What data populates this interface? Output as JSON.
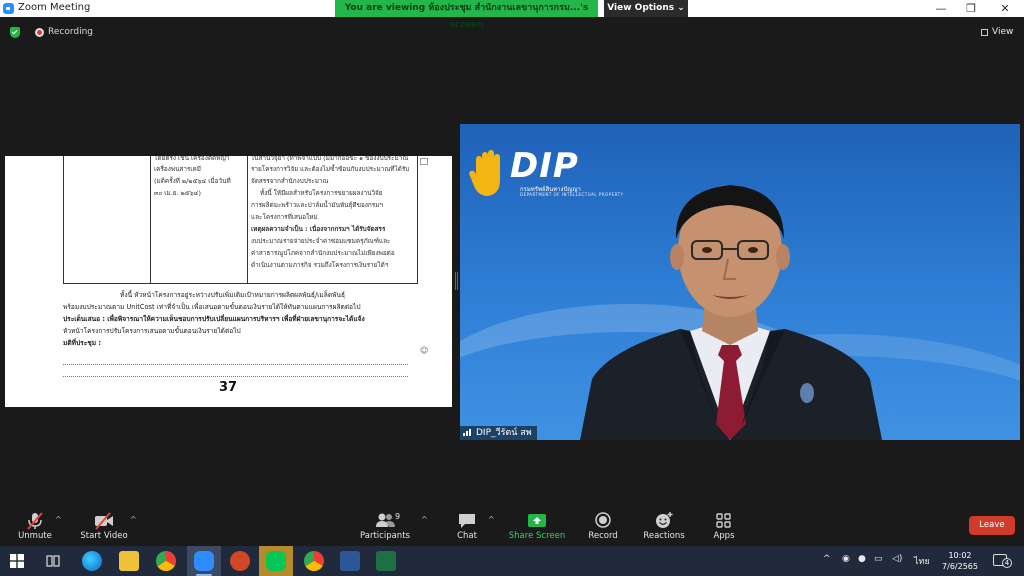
{
  "window": {
    "title": "Zoom Meeting",
    "viewing_banner": "You are viewing ห้องประชุม สำนักงานเลขานุการกรม...'s screen",
    "view_options": "View Options",
    "view_options_chevron": "⌄",
    "minimize": "—",
    "restore": "❐",
    "close": "✕"
  },
  "meeting": {
    "recording_label": "Recording",
    "view_label": "View"
  },
  "document": {
    "cell_col2": [
      "โดยตรง เช่น เครื่องตัดหญ้า",
      "เครื่องพ่นสารเคมี",
      "(มติครั้งที่ ๒/๒๕๖๔ เมื่อวันที่",
      "๓๐ เม.ย. ๒๕๖๔)"
    ],
    "cell_col3": [
      "ในสานวจุยา (ทาพจาแบบ (มมาก้ออขะ ๑ ของงบประมาณ",
      "รายโครงการวิจัย และต้องไม่ซ้ำซ้อนกับงบประมาณที่ได้รับ",
      "จัดสรรจากสำนักงบประมาณ",
      "ทั้งนี้ ให้มีผลสำหรับโครงการขยายผลงานวิจัย",
      "การผลิตมะพร้าวและปาล์มน้ำมันพันธุ์ดีของกรมฯ",
      "และโครงการที่เสนอใหม่",
      "เหตุผลความจำเป็น : เนื่องจากกรมฯ ได้รับจัดสรร",
      "งบประมาณรายจ่ายประจำค่าซ่อมแซมครุภัณฑ์และ",
      "ค่าสาธารณูปโภคจากสำนักงบประมาณไม่เพียงพอต่อ",
      "ดำเนินงานตามภารกิจ รวมถึงโครงการเงินรายได้ฯ"
    ],
    "paragraph": [
      "ทั้งนี้ หัวหน้าโครงการอยู่ระหว่างปรับเพิ่มเติมเป้าหมายการผลิตผลพันธุ์/เมล็ดพันธุ์",
      "พร้อมงบประมาณตาม UnitCost เท่าที่จำเป็น เพื่อเสนอตามขั้นตอนเงินรายได้ให้ทันตามแผนการผลิตต่อไป",
      "ประเด็นเสนอ : เพื่อพิจารณาให้ความเห็นชอบการปรับเปลี่ยนแผนการบริหารฯ เพื่อที่ฝ่ายเลขานุการจะได้แจ้ง",
      "หัวหน้าโครงการปรับโครงการเสนอตามขั้นตอนเงินรายได้ต่อไป",
      "มติที่ประชุม :"
    ],
    "page_number": "37",
    "side_mark": "☺"
  },
  "video": {
    "logo_text": "DIP",
    "logo_sub": "กรมทรัพย์สินทางปัญญา",
    "logo_sub2": "DEPARTMENT OF INTELLECTUAL PROPERTY",
    "participant_name": "DIP_วีรัตน์ สพ"
  },
  "toolbar": {
    "unmute": "Unmute",
    "start_video": "Start Video",
    "participants": "Participants",
    "participants_count": "9",
    "chat": "Chat",
    "share_screen": "Share Screen",
    "record": "Record",
    "reactions": "Reactions",
    "apps": "Apps",
    "leave": "Leave",
    "caret": "^"
  },
  "taskbar": {
    "language": "ไทย",
    "time": "10:02",
    "date": "7/6/2565",
    "notification_count": "4",
    "tray_chevron": "^"
  },
  "colors": {
    "zoom_blue": "#2d8cff",
    "banner_green": "#23b74a",
    "leave_red": "#d13b2a",
    "share_green": "#3ad16a"
  }
}
